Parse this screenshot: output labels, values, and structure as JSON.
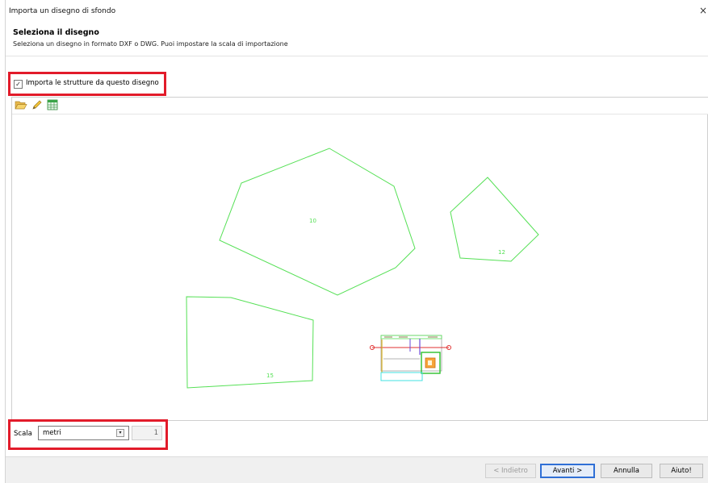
{
  "window": {
    "title": "Importa un disegno di sfondo",
    "close_glyph": "×"
  },
  "header": {
    "title": "Seleziona il disegno",
    "subtitle": "Seleziona un disegno in formato DXF o DWG. Puoi impostare la scala di importazione"
  },
  "import_checkbox": {
    "label": "Importa le strutture da questo disegno",
    "checked": true,
    "glyph": "✓"
  },
  "toolbar": {
    "icons": [
      "folder-open-icon",
      "pencil-edit-icon",
      "spreadsheet-icon"
    ]
  },
  "drawing": {
    "line_color": "#55e055",
    "labels": {
      "shape_10": "10",
      "shape_12": "12",
      "shape_15": "15"
    }
  },
  "scale": {
    "label": "Scala",
    "unit": "metri",
    "value": "1",
    "arrow_glyph": "▾"
  },
  "buttons": {
    "back": "< Indietro",
    "next": "Avanti >",
    "cancel": "Annulla",
    "help": "Aiuto!"
  },
  "colors": {
    "highlight_box": "#e21b2a",
    "default_button_border": "#2f6fd6"
  }
}
